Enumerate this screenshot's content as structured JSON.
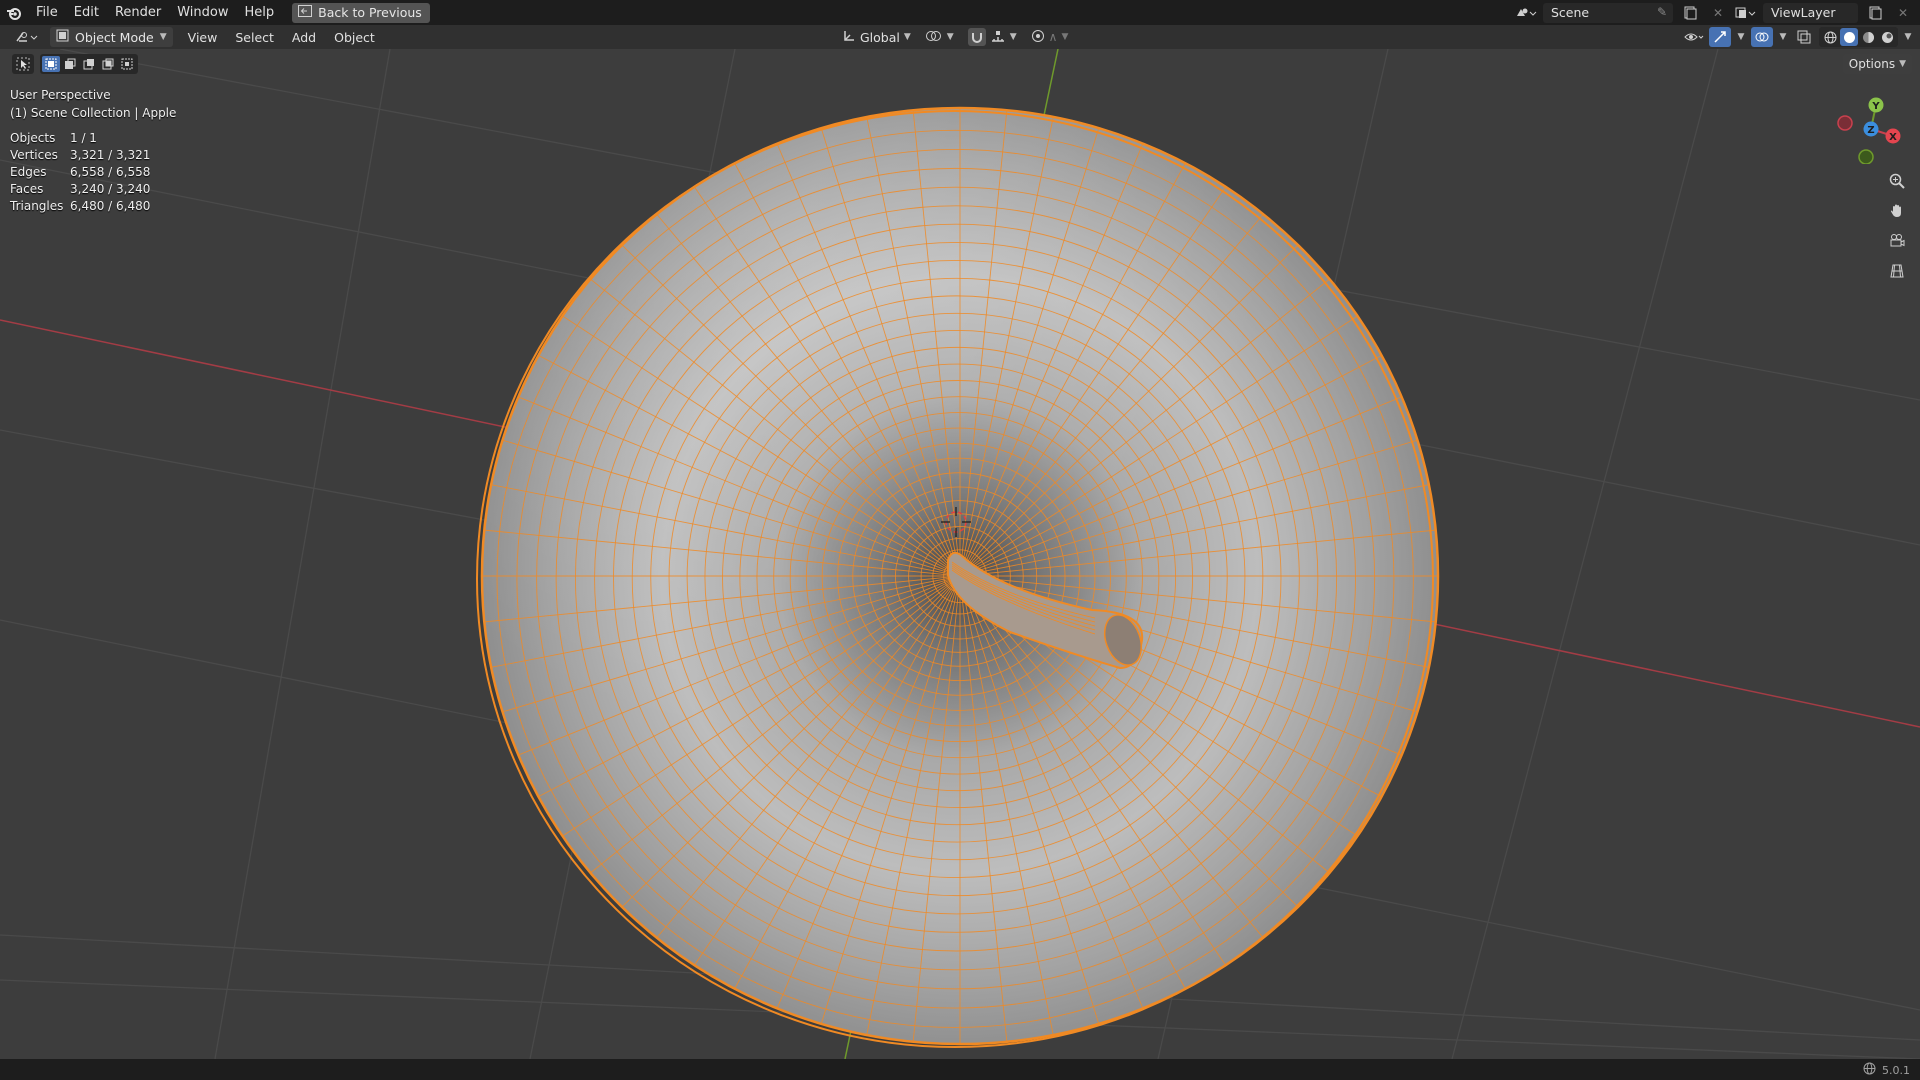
{
  "topbar": {
    "menus": [
      "File",
      "Edit",
      "Render",
      "Window",
      "Help"
    ],
    "back_button": "Back to Previous",
    "scene": "Scene",
    "view_layer": "ViewLayer"
  },
  "header": {
    "mode": "Object Mode",
    "menus": [
      "View",
      "Select",
      "Add",
      "Object"
    ],
    "transform_orientation": "Global"
  },
  "viewport": {
    "view_name": "User Perspective",
    "collection": "(1) Scene Collection | Apple",
    "options_label": "Options",
    "stats": [
      {
        "label": "Objects",
        "value": "1 / 1"
      },
      {
        "label": "Vertices",
        "value": "3,321 / 3,321"
      },
      {
        "label": "Edges",
        "value": "6,558 / 6,558"
      },
      {
        "label": "Faces",
        "value": "3,240 / 3,240"
      },
      {
        "label": "Triangles",
        "value": "6,480 / 6,480"
      }
    ],
    "gizmo": {
      "x": "X",
      "y": "Y",
      "z": "Z"
    },
    "selection_color": "#f08a24"
  },
  "statusbar": {
    "version": "5.0.1"
  }
}
